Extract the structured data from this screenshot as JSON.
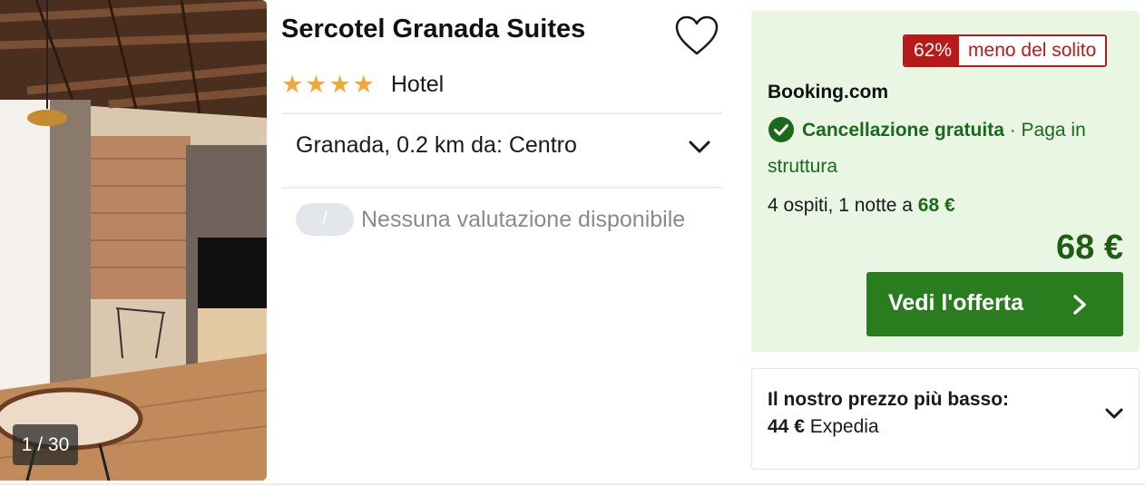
{
  "hotel": {
    "name": "Sercotel Granada Suites",
    "stars": "★★★★",
    "star_rating": 4,
    "type": "Hotel",
    "location": "Granada, 0.2 km da: Centro",
    "rating_pill": "/",
    "rating_text": "Nessuna valutazione disponibile",
    "photo_counter": "1 / 30"
  },
  "deal": {
    "discount_pct": "62%",
    "discount_label": "meno del solito",
    "provider": "Booking.com",
    "cancellation": "Cancellazione gratuita",
    "payment": " · Paga in struttura",
    "guests_text": "4 ospiti, 1 notte a ",
    "guests_price": "68 €",
    "price": "68 €",
    "cta_label": "Vedi l'offerta"
  },
  "lowest": {
    "label": "Il nostro prezzo più basso:",
    "price": "44 €",
    "provider": "Expedia"
  },
  "colors": {
    "accent_green": "#2a7d1e",
    "deal_bg": "#eaf6e4",
    "badge_red": "#b81a1a",
    "star_yellow": "#f2a93b"
  },
  "icons": [
    "heart-icon",
    "chevron-down-icon",
    "check-circle-icon",
    "chevron-right-icon"
  ]
}
